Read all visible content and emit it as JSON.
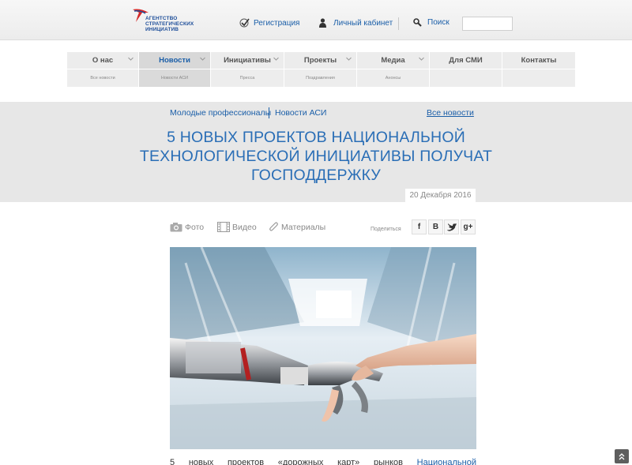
{
  "header": {
    "logo_lines": [
      "АГЕНТСТВО",
      "СТРАТЕГИЧЕСКИХ",
      "ИНИЦИАТИВ"
    ],
    "register_label": "Регистрация",
    "cabinet_label": "Личный кабинет",
    "search_label": "Поиск",
    "search_value": ""
  },
  "nav": [
    {
      "label": "О нас",
      "sub": "Все новости",
      "active": false,
      "dropdown": true
    },
    {
      "label": "Новости",
      "sub": "Новости АСИ",
      "active": true,
      "dropdown": true
    },
    {
      "label": "Инициативы",
      "sub": "Пресса",
      "active": false,
      "dropdown": true
    },
    {
      "label": "Проекты",
      "sub": "Поздравления",
      "active": false,
      "dropdown": true
    },
    {
      "label": "Медиа",
      "sub": "Анонсы",
      "active": false,
      "dropdown": true
    },
    {
      "label": "Для СМИ",
      "sub": "",
      "active": false,
      "dropdown": false
    },
    {
      "label": "Контакты",
      "sub": "",
      "active": false,
      "dropdown": false
    }
  ],
  "breadcrumb": {
    "first": "Молодые профессионалы",
    "second": "Новости АСИ",
    "all_news": "Все новости"
  },
  "article": {
    "title": "5 НОВЫХ ПРОЕКТОВ НАЦИОНАЛЬНОЙ ТЕХНОЛОГИЧЕСКОЙ ИНИЦИАТИВЫ ПОЛУЧАТ ГОСПОДДЕРЖКУ",
    "date": "20 Декабря 2016",
    "body_words": [
      "5",
      "новых",
      "проектов",
      "«дорожных",
      "карт»",
      "рынков"
    ],
    "body_link": "Национальной"
  },
  "media": {
    "photo_label": "Фото",
    "video_label": "Видео",
    "materials_label": "Материалы",
    "share_label": "Поделиться",
    "share_buttons": [
      "f",
      "B",
      "t",
      "g+"
    ]
  },
  "colors": {
    "accent": "#1a5ea8",
    "title": "#2a6eb6",
    "band": "#e7e7e7"
  }
}
